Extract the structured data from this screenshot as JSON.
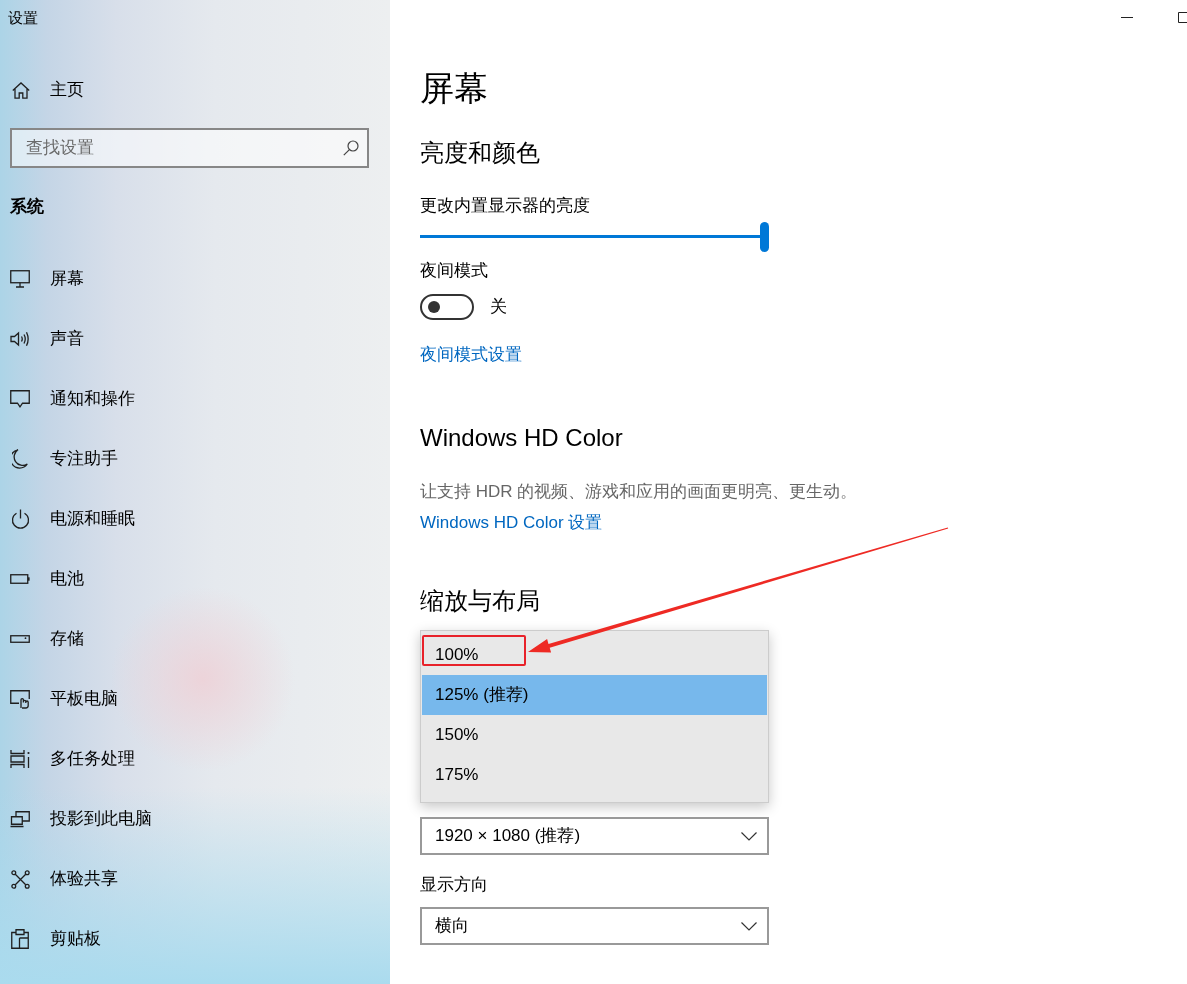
{
  "window": {
    "title": "设置"
  },
  "sidebar": {
    "home": {
      "label": "主页"
    },
    "search": {
      "placeholder": "查找设置"
    },
    "section": "系统",
    "items": [
      {
        "label": "屏幕"
      },
      {
        "label": "声音"
      },
      {
        "label": "通知和操作"
      },
      {
        "label": "专注助手"
      },
      {
        "label": "电源和睡眠"
      },
      {
        "label": "电池"
      },
      {
        "label": "存储"
      },
      {
        "label": "平板电脑"
      },
      {
        "label": "多任务处理"
      },
      {
        "label": "投影到此电脑"
      },
      {
        "label": "体验共享"
      },
      {
        "label": "剪贴板"
      }
    ]
  },
  "page": {
    "title": "屏幕",
    "brightness": {
      "heading": "亮度和颜色",
      "label": "更改内置显示器的亮度",
      "level": 1
    },
    "night_light": {
      "label": "夜间模式",
      "on": false,
      "state_text": "关",
      "link": "夜间模式设置"
    },
    "hd_color": {
      "heading": "Windows HD Color",
      "description": "让支持 HDR 的视频、游戏和应用的画面更明亮、更生动。",
      "link": "Windows HD Color 设置"
    },
    "scale_layout": {
      "heading": "缩放与布局",
      "scale_menu": {
        "options": [
          {
            "label": "100%",
            "selected": false,
            "annotated": true
          },
          {
            "label": "125% (推荐)",
            "selected": true,
            "annotated": false
          },
          {
            "label": "150%",
            "selected": false,
            "annotated": false
          },
          {
            "label": "175%",
            "selected": false,
            "annotated": false
          }
        ]
      },
      "resolution": {
        "value": "1920 × 1080 (推荐)"
      },
      "orientation": {
        "label": "显示方向",
        "value": "横向"
      }
    }
  }
}
